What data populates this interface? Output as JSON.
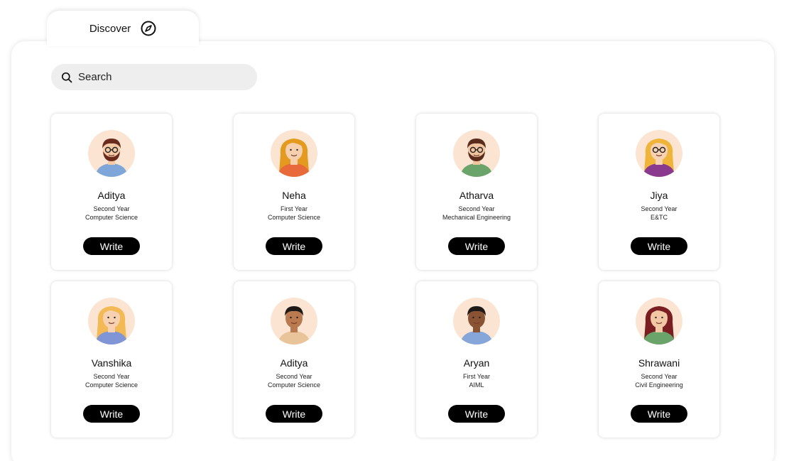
{
  "tab": {
    "label": "Discover",
    "icon": "compass-icon"
  },
  "search": {
    "placeholder": "Search",
    "icon": "search-icon"
  },
  "people": [
    {
      "name": "Aditya",
      "year": "Second Year",
      "department": "Computer Science",
      "button": "Write",
      "skin": "#f3c9a6",
      "hair": "#6b2a1e",
      "shirt": "#7ea6d8",
      "beard": true,
      "glasses": true,
      "longHair": false
    },
    {
      "name": "Neha",
      "year": "First Year",
      "department": "Computer Science",
      "button": "Write",
      "skin": "#f5cfae",
      "hair": "#e39a1f",
      "shirt": "#e86a3a",
      "beard": false,
      "glasses": false,
      "longHair": true
    },
    {
      "name": "Atharva",
      "year": "Second Year",
      "department": "Mechanical Engineering",
      "button": "Write",
      "skin": "#f1c4a0",
      "hair": "#5a2c1c",
      "shirt": "#6aa46a",
      "beard": true,
      "glasses": true,
      "longHair": false
    },
    {
      "name": "Jiya",
      "year": "Second Year",
      "department": "E&TC",
      "button": "Write",
      "skin": "#f6d2b2",
      "hair": "#f0b43a",
      "shirt": "#8a3a8e",
      "beard": false,
      "glasses": true,
      "longHair": true
    },
    {
      "name": "Vanshika",
      "year": "Second Year",
      "department": "Computer Science",
      "button": "Write",
      "skin": "#f6d2b2",
      "hair": "#f2b955",
      "shirt": "#7f95d6",
      "beard": false,
      "glasses": false,
      "longHair": true
    },
    {
      "name": "Aditya",
      "year": "Second Year",
      "department": "Computer Science",
      "button": "Write",
      "skin": "#b87a4e",
      "hair": "#1e1a18",
      "shirt": "#e9c49a",
      "beard": false,
      "glasses": false,
      "longHair": false
    },
    {
      "name": "Aryan",
      "year": "First Year",
      "department": "AIML",
      "button": "Write",
      "skin": "#8a5434",
      "hair": "#1e1a18",
      "shirt": "#86a6da",
      "beard": false,
      "glasses": false,
      "longHair": false
    },
    {
      "name": "Shrawani",
      "year": "Second Year",
      "department": "Civil Engineering",
      "button": "Write",
      "skin": "#f2c7a4",
      "hair": "#7a1e22",
      "shirt": "#6aa46a",
      "beard": false,
      "glasses": false,
      "longHair": true
    }
  ],
  "colors": {
    "button_bg": "#000000",
    "button_text": "#ffffff",
    "search_bg": "#eeeeee",
    "avatar_bg": "#fbe5d2"
  }
}
